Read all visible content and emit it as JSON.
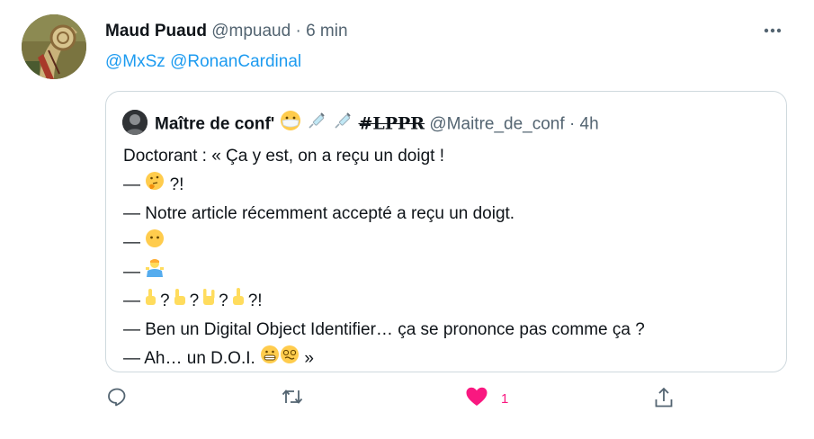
{
  "tweet": {
    "display_name": "Maud Puaud",
    "handle": "@mpuaud",
    "separator": "·",
    "time": "6 min",
    "reply_mentions": [
      "@MxSz",
      "@RonanCardinal"
    ]
  },
  "quoted": {
    "display_name": "Maître de conf'",
    "tag": "#LPPR",
    "handle": "@Maitre_de_conf",
    "separator": "·",
    "time": "4h",
    "lines": {
      "l1": "Doctorant : « Ça y est, on a reçu un doigt !",
      "dash": "—",
      "l2_text": "?!",
      "l3": "— Notre article récemment accepté a reçu un doigt.",
      "q": "?",
      "excl": "?!",
      "l7": "— Ben un Digital Object Identifier… ça se prononce pas comme ça ?",
      "l8_text": "— Ah… un D.O.I.",
      "l8_end": "»"
    }
  },
  "actions": {
    "like_count": "1"
  },
  "colors": {
    "link": "#1d9bf0",
    "muted": "#536471",
    "like": "#f91880",
    "border": "#cfd9de"
  }
}
